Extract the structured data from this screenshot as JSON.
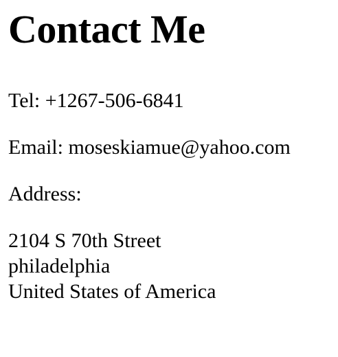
{
  "page": {
    "title": "Contact Me",
    "tel_label": "Tel:",
    "tel_value": "+1267-506-6841",
    "email_label": "Email:",
    "email_value": "moseskiamue@yahoo.com",
    "address_label": "Address:",
    "address_lines": [
      "2104 S 70th Street",
      "philadelphia",
      "United States of America"
    ]
  }
}
